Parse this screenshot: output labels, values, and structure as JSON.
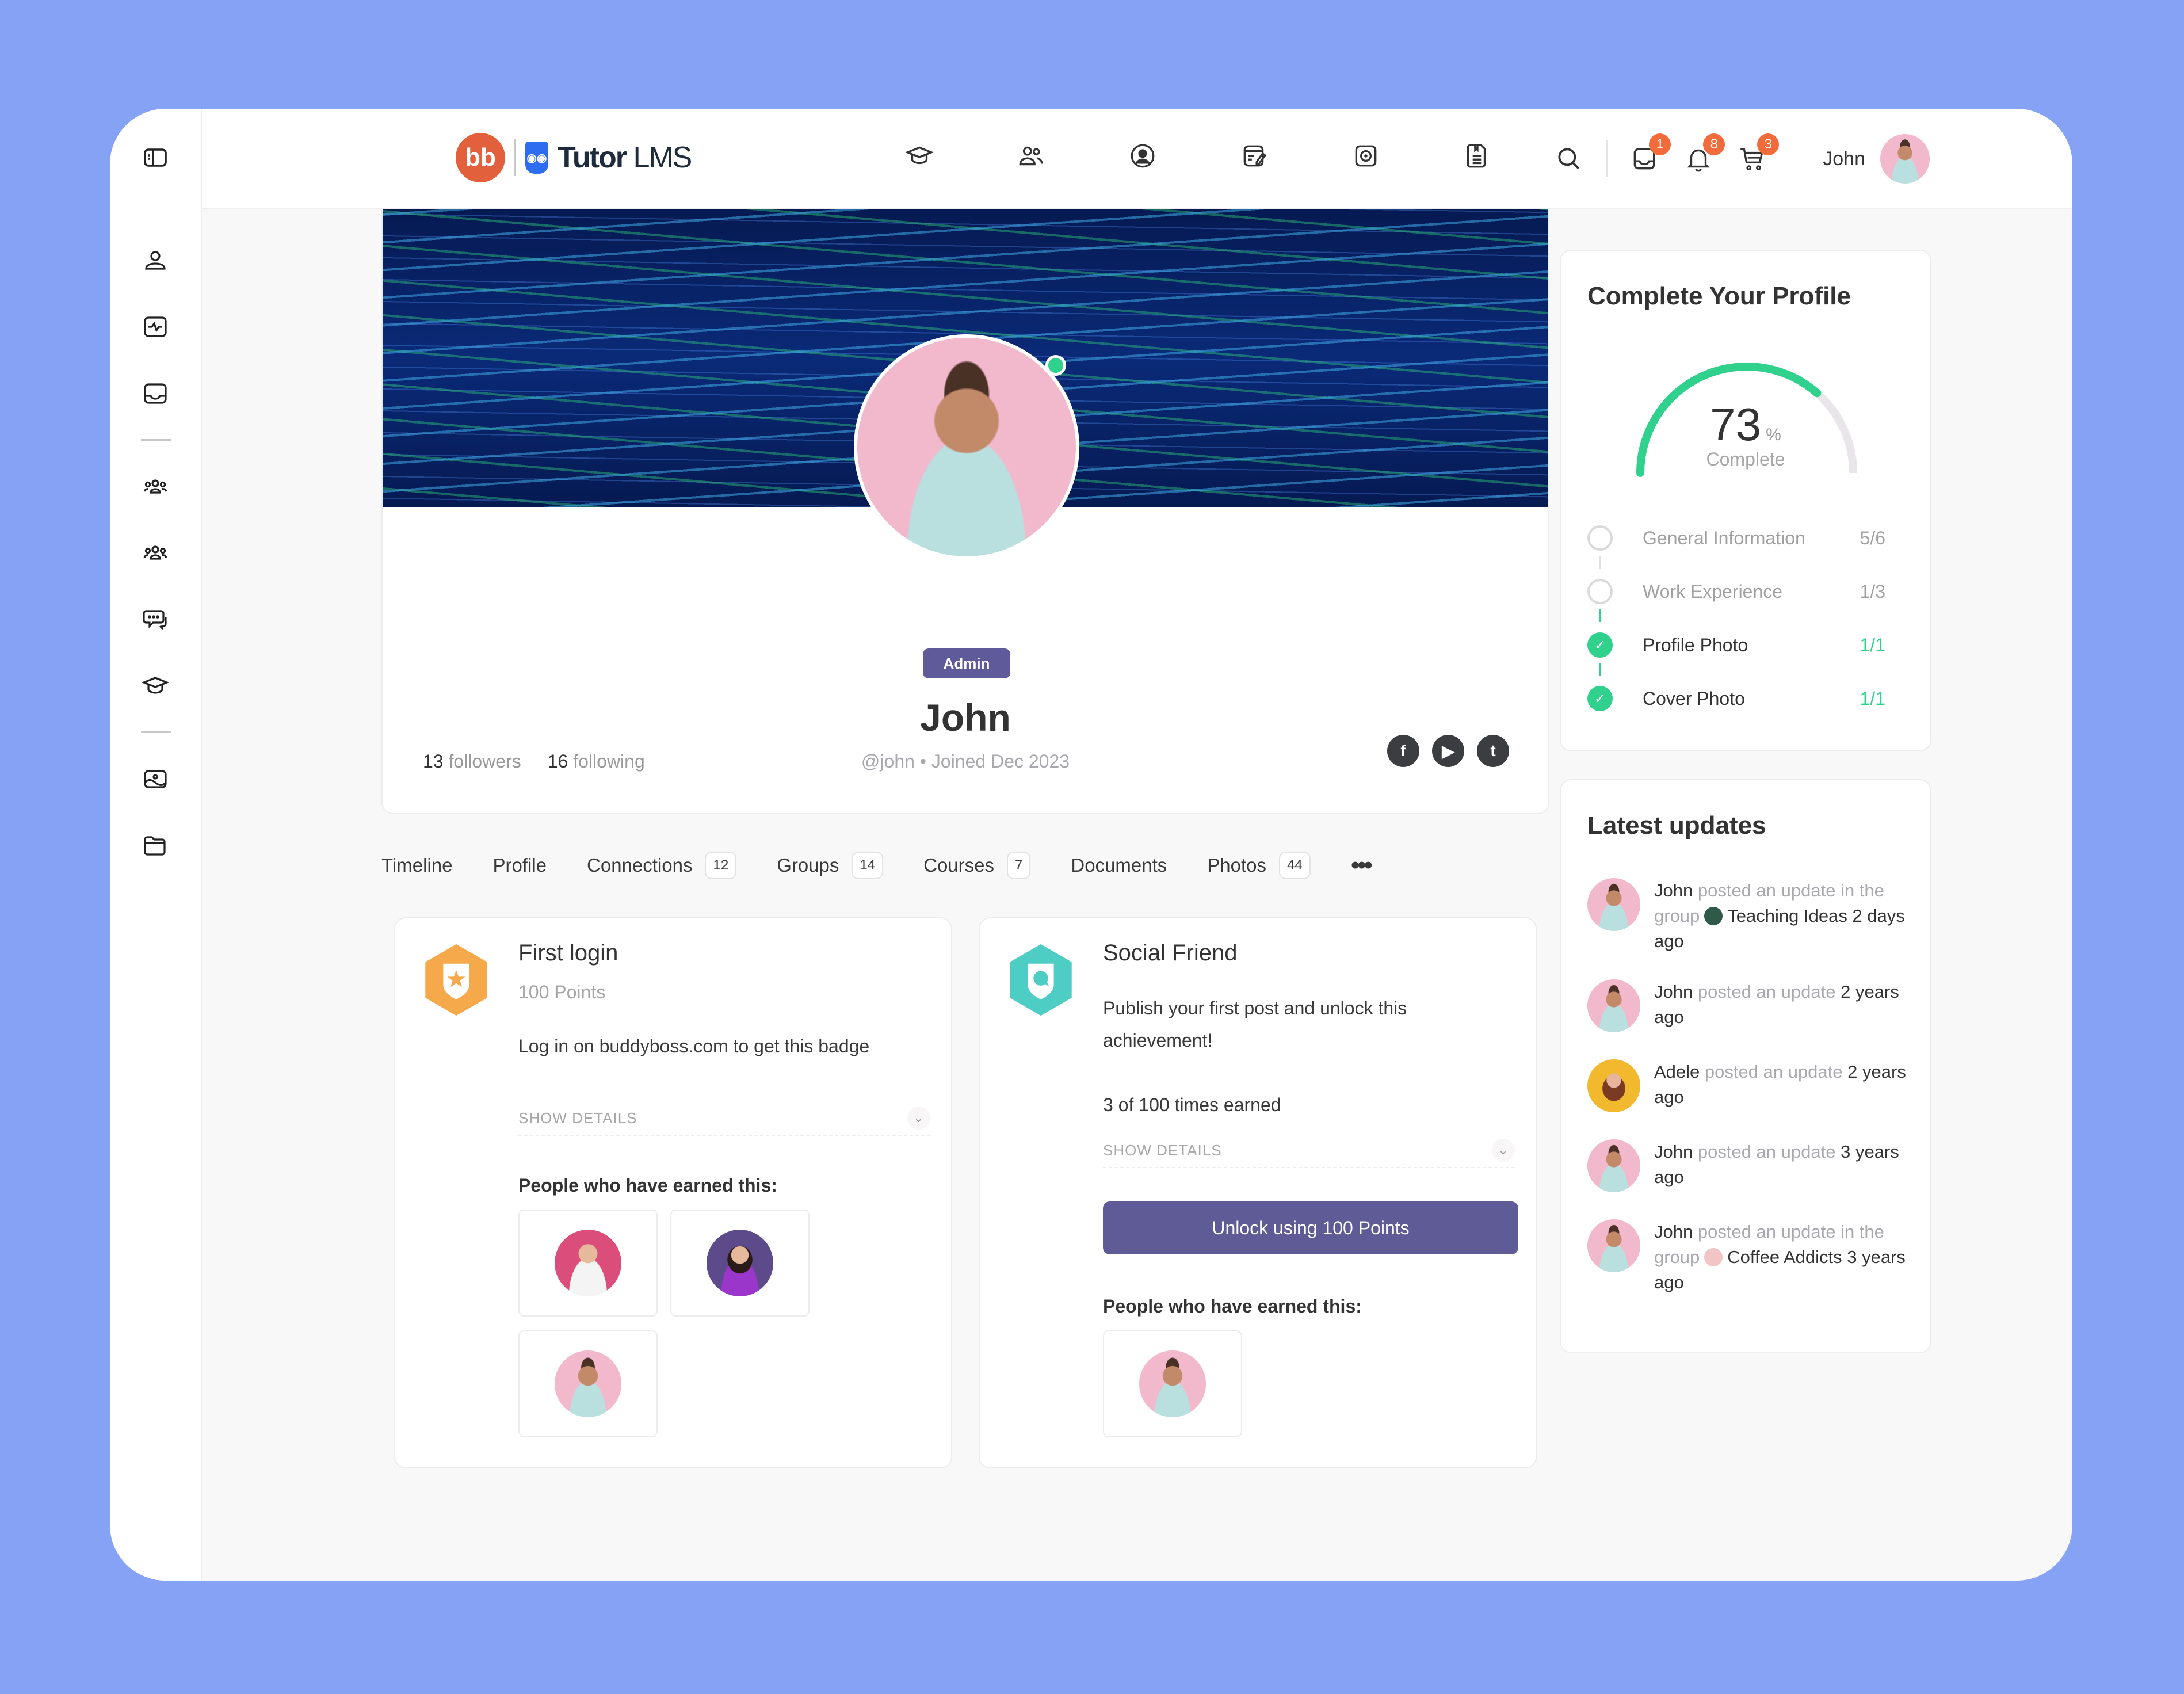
{
  "header": {
    "brand_left": "bb",
    "brand_name_bold": "Tutor",
    "brand_name_light": "LMS",
    "nav_icons": [
      "courses-icon",
      "members-icon",
      "profile-icon",
      "blog-icon",
      "photos-icon",
      "documents-icon"
    ],
    "badges": {
      "messages": "1",
      "notifications": "8",
      "cart": "3"
    },
    "user_name": "John"
  },
  "sidebar": {
    "items": [
      "toggle-sidebar",
      "profile",
      "activity",
      "inbox",
      "groups",
      "members",
      "forums",
      "courses",
      "photos",
      "documents"
    ]
  },
  "profile": {
    "role_badge": "Admin",
    "name": "John",
    "handle_line": "@john • Joined Dec 2023",
    "followers_count": "13",
    "followers_label": "followers",
    "following_count": "16",
    "following_label": "following",
    "social": [
      "facebook",
      "youtube",
      "twitter"
    ],
    "online": true
  },
  "tabs": [
    {
      "label": "Timeline"
    },
    {
      "label": "Profile"
    },
    {
      "label": "Connections",
      "count": "12"
    },
    {
      "label": "Groups",
      "count": "14"
    },
    {
      "label": "Courses",
      "count": "7"
    },
    {
      "label": "Documents"
    },
    {
      "label": "Photos",
      "count": "44"
    }
  ],
  "tabs_more": "•••",
  "achievements": [
    {
      "title": "First login",
      "points": "100 Points",
      "description": "Log in on buddyboss.com to get this badge",
      "show_details": "SHOW DETAILS",
      "people_label": "People who have earned this:",
      "color": "#f5a94a",
      "earners": [
        "man-doctor",
        "woman-purple",
        "john"
      ]
    },
    {
      "title": "Social Friend",
      "description": "Publish your first post and unlock this achievement!",
      "times_earned": "3 of 100 times earned",
      "show_details": "SHOW DETAILS",
      "unlock_label": "Unlock using 100 Points",
      "people_label": "People who have earned this:",
      "color": "#4ecdc4",
      "earners": [
        "john"
      ]
    }
  ],
  "complete_profile": {
    "title": "Complete Your Profile",
    "percent": 73,
    "percent_text": "73",
    "percent_sign": "%",
    "label": "Complete",
    "steps": [
      {
        "label": "General Information",
        "progress": "5/6",
        "done": false
      },
      {
        "label": "Work Experience",
        "progress": "1/3",
        "done": false
      },
      {
        "label": "Profile Photo",
        "progress": "1/1",
        "done": true
      },
      {
        "label": "Cover Photo",
        "progress": "1/1",
        "done": true
      }
    ]
  },
  "latest_updates": {
    "title": "Latest updates",
    "items": [
      {
        "user": "John",
        "action": "posted an update in the group",
        "group": "Teaching Ideas",
        "time": "2 days ago",
        "avatar": "john"
      },
      {
        "user": "John",
        "action": "posted an update",
        "time": "2 years ago",
        "avatar": "john"
      },
      {
        "user": "Adele",
        "action": "posted an update",
        "time": "2 years ago",
        "avatar": "adele"
      },
      {
        "user": "John",
        "action": "posted an update",
        "time": "3 years ago",
        "avatar": "john"
      },
      {
        "user": "John",
        "action": "posted an update in the group",
        "group": "Coffee Addicts",
        "time": "3 years ago",
        "avatar": "john"
      }
    ]
  },
  "colors": {
    "background": "#86a2f4",
    "accent_green": "#2fd18d",
    "badge_orange": "#f26b3a",
    "admin_purple": "#5f5b9a",
    "brand_orange": "#e2603c",
    "brand_blue": "#2f6df0"
  }
}
